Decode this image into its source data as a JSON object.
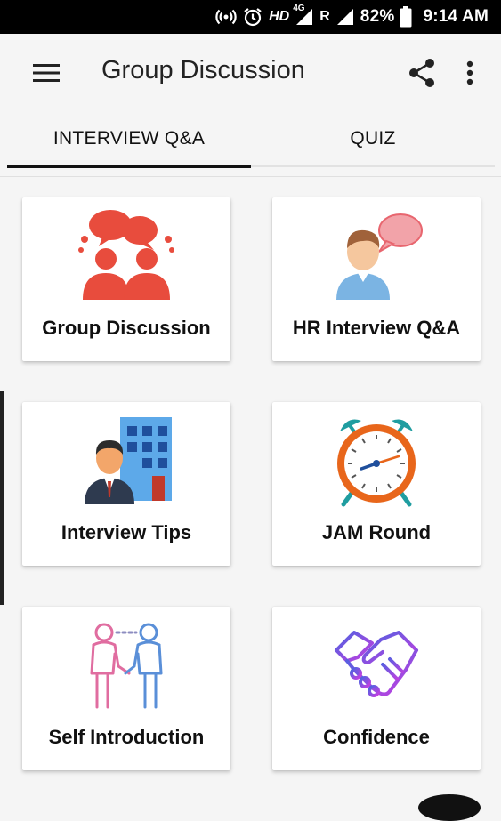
{
  "status_bar": {
    "network": "HD",
    "network_type": "4G",
    "roaming": "R",
    "battery": "82%",
    "time": "9:14 AM"
  },
  "app_bar": {
    "title": "Group Discussion",
    "icons": [
      "menu-icon",
      "share-icon",
      "more-vert-icon"
    ]
  },
  "tabs": [
    {
      "label": "INTERVIEW Q&A",
      "selected": true
    },
    {
      "label": "QUIZ",
      "selected": false
    }
  ],
  "cards": [
    {
      "label": "Group Discussion",
      "icon": "group-discussion-icon"
    },
    {
      "label": "HR Interview Q&A",
      "icon": "hr-interview-icon"
    },
    {
      "label": "Interview Tips",
      "icon": "interview-tips-icon"
    },
    {
      "label": "JAM Round",
      "icon": "alarm-clock-icon"
    },
    {
      "label": "Self Introduction",
      "icon": "handshake-people-icon"
    },
    {
      "label": "Confidence",
      "icon": "handshake-icon"
    }
  ],
  "colors": {
    "red": "#e84c3d",
    "blue": "#3f8fd6",
    "orange": "#e8661b",
    "teal": "#1f9da0",
    "purple": "#8a3dd6",
    "dark": "#111111"
  }
}
